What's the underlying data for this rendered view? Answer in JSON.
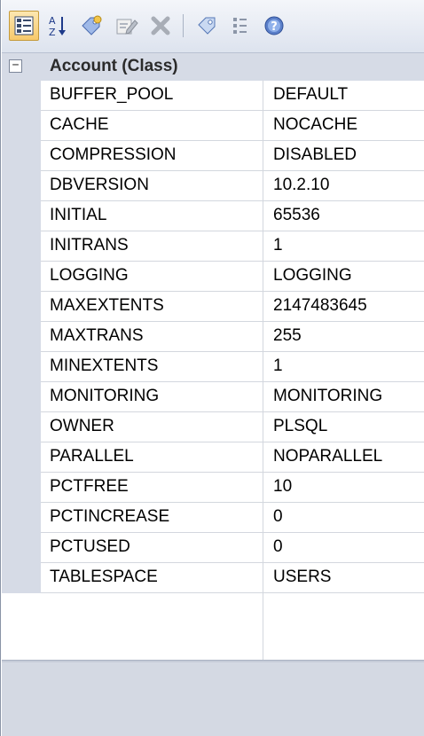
{
  "toolbar": {
    "buttons": [
      {
        "icon": "categorized-icon",
        "pressed": true
      },
      {
        "icon": "sort-alpha-icon",
        "label": "A↓Z"
      },
      {
        "icon": "new-tagged-value-icon"
      },
      {
        "icon": "edit-icon"
      },
      {
        "icon": "delete-icon"
      },
      {
        "icon": "tag-icon"
      },
      {
        "icon": "filter-icon"
      },
      {
        "icon": "help-icon"
      }
    ]
  },
  "category": {
    "toggle": "−",
    "label": "Account (Class)"
  },
  "properties": [
    {
      "name": "BUFFER_POOL",
      "value": "DEFAULT"
    },
    {
      "name": "CACHE",
      "value": "NOCACHE"
    },
    {
      "name": "COMPRESSION",
      "value": "DISABLED"
    },
    {
      "name": "DBVERSION",
      "value": "10.2.10"
    },
    {
      "name": "INITIAL",
      "value": "65536"
    },
    {
      "name": "INITRANS",
      "value": "1"
    },
    {
      "name": "LOGGING",
      "value": "LOGGING"
    },
    {
      "name": "MAXEXTENTS",
      "value": "2147483645"
    },
    {
      "name": "MAXTRANS",
      "value": "255"
    },
    {
      "name": "MINEXTENTS",
      "value": "1"
    },
    {
      "name": "MONITORING",
      "value": "MONITORING"
    },
    {
      "name": "OWNER",
      "value": "PLSQL"
    },
    {
      "name": "PARALLEL",
      "value": "NOPARALLEL"
    },
    {
      "name": "PCTFREE",
      "value": "10"
    },
    {
      "name": "PCTINCREASE",
      "value": "0"
    },
    {
      "name": "PCTUSED",
      "value": "0"
    },
    {
      "name": "TABLESPACE",
      "value": "USERS"
    }
  ],
  "colors": {
    "gutter": "#d6dbe6",
    "grid_line": "#d3d7de",
    "pressed": "#f7c96b"
  }
}
